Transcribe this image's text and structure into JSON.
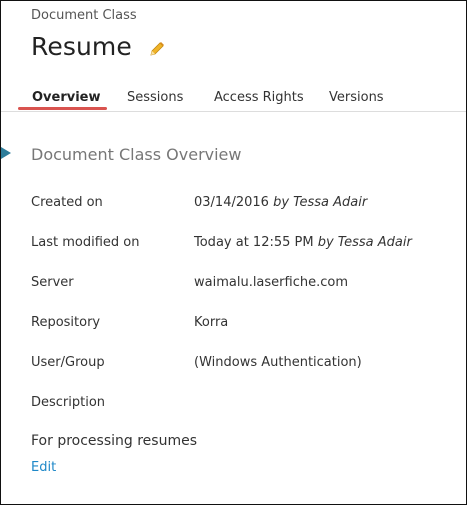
{
  "header": {
    "breadcrumb": "Document Class",
    "title": "Resume",
    "edit_icon": "pencil-icon"
  },
  "tabs": [
    {
      "label": "Overview",
      "active": true
    },
    {
      "label": "Sessions",
      "active": false
    },
    {
      "label": "Access Rights",
      "active": false
    },
    {
      "label": "Versions",
      "active": false
    }
  ],
  "section": {
    "title": "Document Class Overview"
  },
  "details": {
    "created_on": {
      "label": "Created on",
      "date": "03/14/2016",
      "by": "by Tessa Adair"
    },
    "last_modified": {
      "label": "Last modified on",
      "date": "Today at 12:55 PM",
      "by": "by Tessa Adair"
    },
    "server": {
      "label": "Server",
      "value": "waimalu.laserfiche.com"
    },
    "repository": {
      "label": "Repository",
      "value": "Korra"
    },
    "user_group": {
      "label": "User/Group",
      "value": "(Windows Authentication)"
    },
    "description": {
      "label": "Description"
    }
  },
  "description_text": "For processing resumes",
  "edit_link": "Edit",
  "colors": {
    "accent_tab": "#d9534f",
    "section_marker": "#2e7d9a",
    "link": "#1e88c8"
  }
}
